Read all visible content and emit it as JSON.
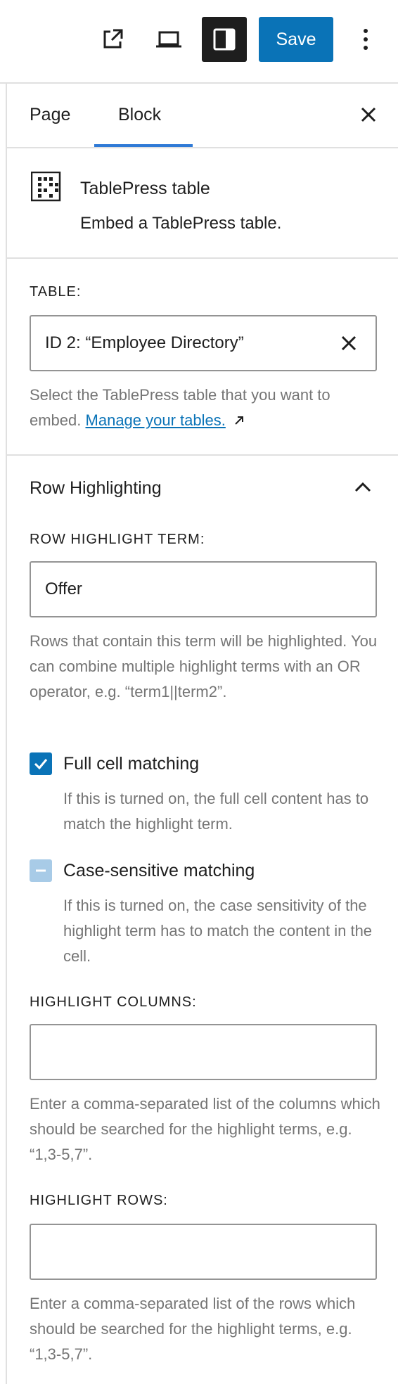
{
  "toolbar": {
    "save_label": "Save",
    "icons": [
      "external-link-icon",
      "desktop-preview-icon",
      "sidebar-toggle-icon",
      "more-options-icon"
    ]
  },
  "tabs": [
    {
      "label": "Page",
      "active": false
    },
    {
      "label": "Block",
      "active": true
    }
  ],
  "block": {
    "title": "TablePress table",
    "description": "Embed a TablePress table."
  },
  "table": {
    "label": "TABLE:",
    "value": "ID 2: “Employee Directory”",
    "help": "Select the TablePress table that you want to embed.",
    "link_label": "Manage your tables."
  },
  "row_highlighting": {
    "title": "Row Highlighting",
    "term_label": "ROW HIGHLIGHT TERM:",
    "term_value": "Offer",
    "term_help": "Rows that contain this term will be highlighted. You can combine multiple highlight terms with an OR operator, e.g. “term1||term2”.",
    "full_cell": {
      "label": "Full cell matching",
      "checked": true,
      "help": "If this is turned on, the full cell content has to match the highlight term."
    },
    "case_sensitive": {
      "label": "Case-sensitive matching",
      "checked": "indeterminate",
      "help": "If this is turned on, the case sensitivity of the highlight term has to match the content in the cell."
    },
    "columns_label": "HIGHLIGHT COLUMNS:",
    "columns_value": "",
    "columns_help": "Enter a comma-separated list of the columns which should be searched for the highlight terms, e.g. “1,3-5,7”.",
    "rows_label": "HIGHLIGHT ROWS:",
    "rows_value": "",
    "rows_help": "Enter a comma-separated list of the rows which should be searched for the highlight terms, e.g. “1,3-5,7”."
  },
  "colors": {
    "accent": "#0a73b7",
    "tab_indicator": "#2f7ad6",
    "muted_text": "#757575",
    "border": "#e0e0e0",
    "checkbox_indeterminate": "#a8cbe7"
  }
}
